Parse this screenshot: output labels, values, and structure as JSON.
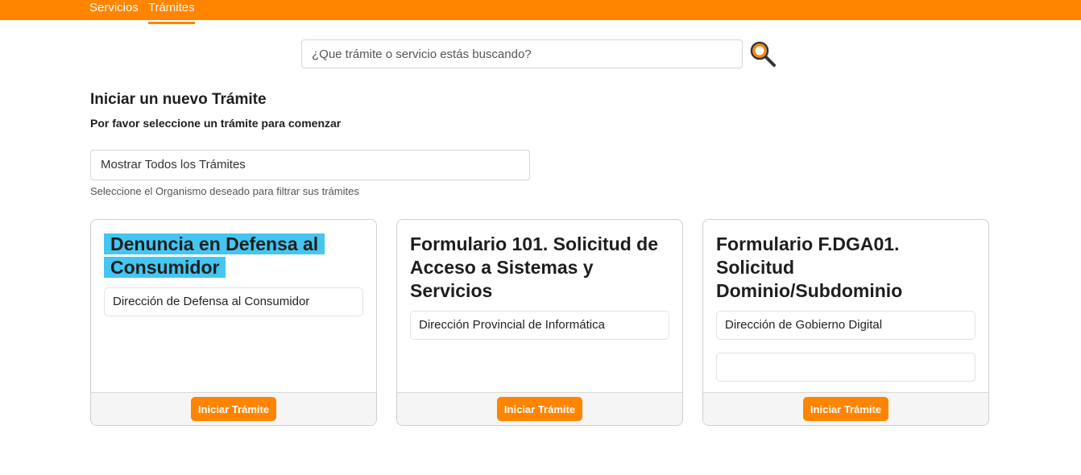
{
  "nav": {
    "items": [
      {
        "label": "Servicios"
      },
      {
        "label": "Trámites"
      }
    ]
  },
  "search": {
    "placeholder": "¿Que trámite o servicio estás buscando?",
    "value": ""
  },
  "section": {
    "title": "Iniciar un nuevo Trámite",
    "subtitle": "Por favor seleccione un trámite para comenzar"
  },
  "filter": {
    "selected": "Mostrar Todos los Trámites",
    "help": "Seleccione el Organismo deseado para filtrar sus trámites"
  },
  "cards": [
    {
      "title_lines": [
        "Denuncia en Defensa al",
        "Consumidor"
      ],
      "organism": "Dirección de Defensa al Consumidor",
      "button": "Iniciar Trámite"
    },
    {
      "title": "Formulario 101. Solicitud de Acceso a Sistemas y Servicios",
      "organism": "Dirección Provincial de Informática",
      "button": "Iniciar Trámite"
    },
    {
      "title": "Formulario F.DGA01. Solicitud Dominio/Subdominio",
      "organism": "Dirección de Gobierno Digital",
      "extra": "",
      "button": "Iniciar Trámite"
    }
  ],
  "colors": {
    "brand": "#ff8400",
    "highlight": "#45c5f0"
  }
}
